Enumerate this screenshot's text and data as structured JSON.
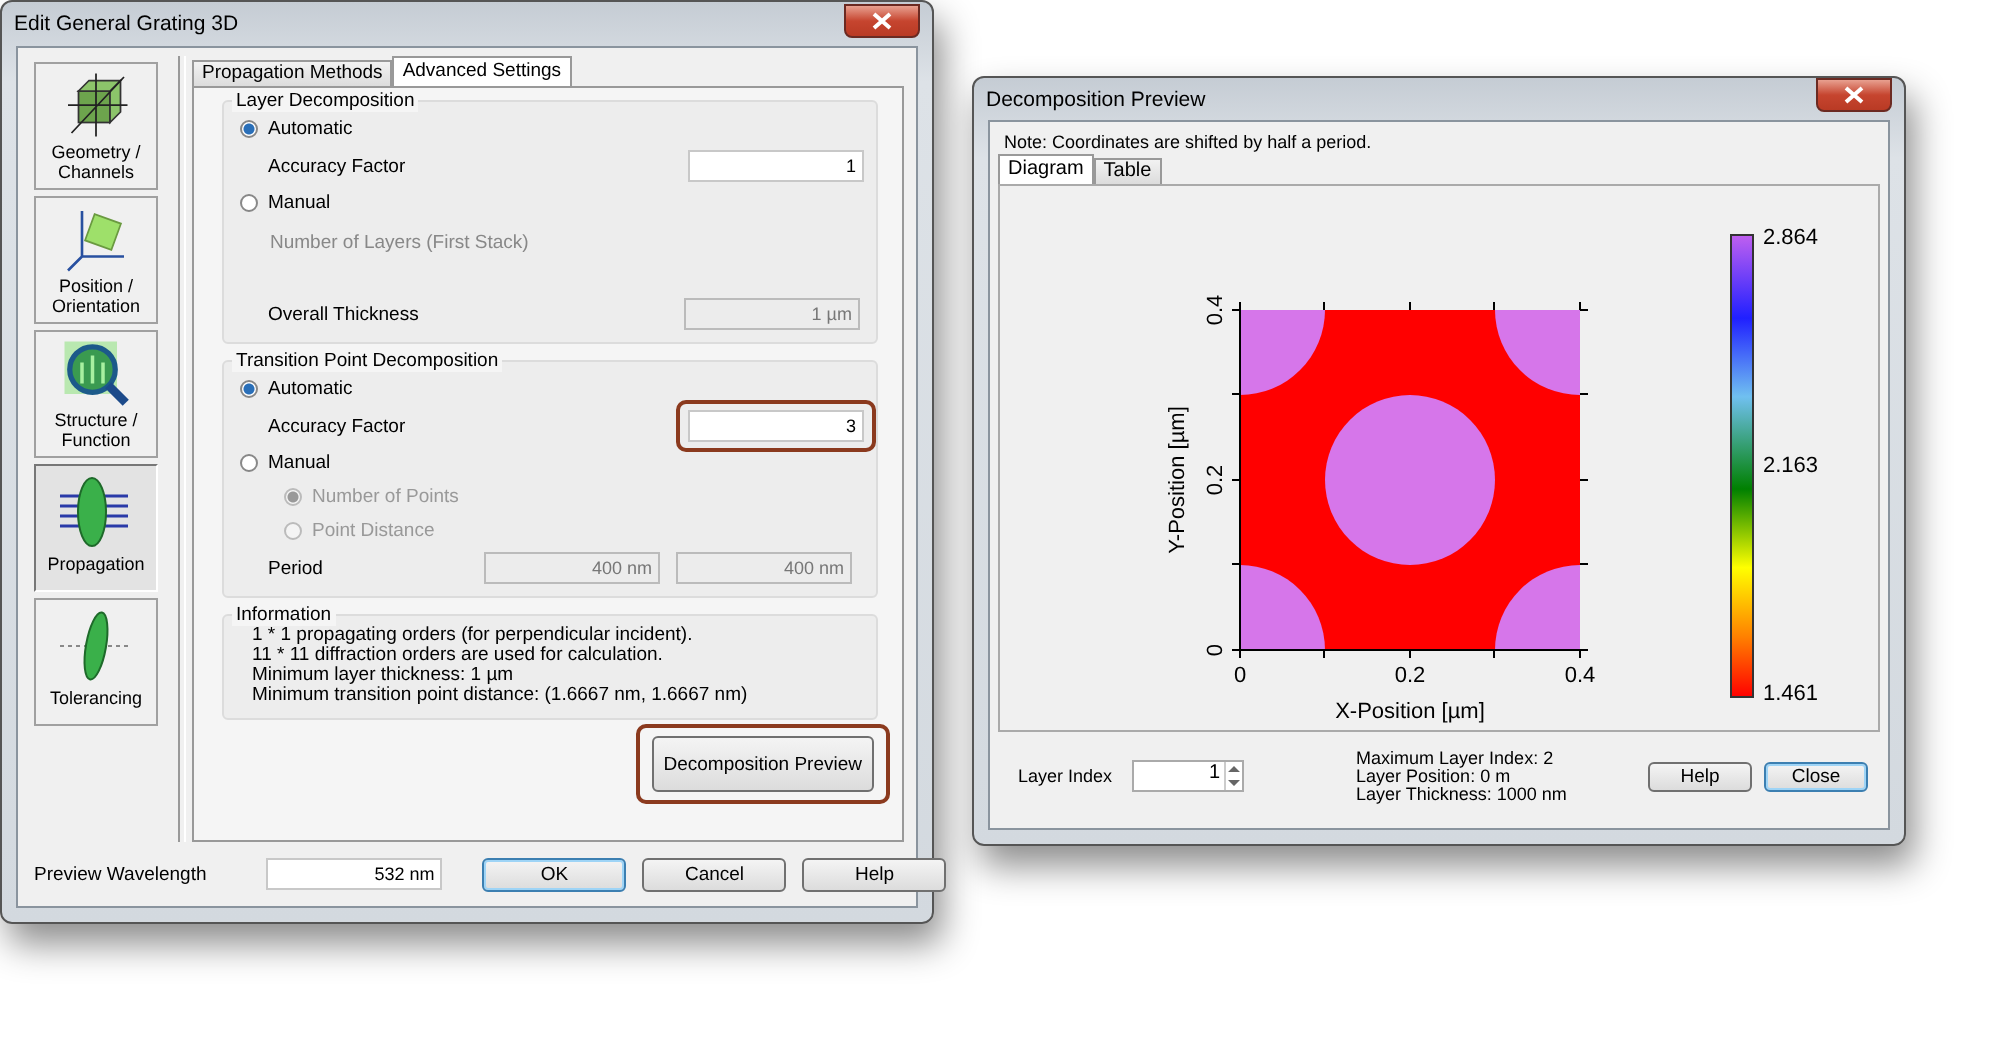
{
  "main_window": {
    "title": "Edit General Grating 3D",
    "sidebar": [
      {
        "label": "Geometry / Channels",
        "kind": "cube",
        "selected": false
      },
      {
        "label": "Position / Orientation",
        "kind": "axes",
        "selected": false
      },
      {
        "label": "Structure / Function",
        "kind": "magnifier",
        "selected": false
      },
      {
        "label": "Propagation",
        "kind": "lens",
        "selected": true
      },
      {
        "label": "Tolerancing",
        "kind": "disc",
        "selected": false
      }
    ],
    "tabs": [
      {
        "label": "Propagation Methods",
        "selected": false
      },
      {
        "label": "Advanced Settings",
        "selected": true
      }
    ],
    "layer_decomposition": {
      "title": "Layer Decomposition",
      "options": [
        {
          "label": "Automatic",
          "selected": true
        },
        {
          "label": "Manual",
          "selected": false
        }
      ],
      "accuracy": {
        "label": "Accuracy Factor",
        "value": "1"
      },
      "layers_label": "Number of Layers (First Stack)",
      "thickness": {
        "label": "Overall Thickness",
        "value": "1 µm",
        "disabled": true
      }
    },
    "transition_decomposition": {
      "title": "Transition Point Decomposition",
      "options": [
        {
          "label": "Automatic",
          "selected": true
        },
        {
          "label": "Manual",
          "selected": false
        }
      ],
      "accuracy": {
        "label": "Accuracy Factor",
        "value": "3",
        "highlighted": true
      },
      "sub_options": [
        {
          "label": "Number of Points",
          "selected": true,
          "disabled": true
        },
        {
          "label": "Point Distance",
          "selected": false,
          "disabled": true
        }
      ],
      "period": {
        "label": "Period",
        "values": [
          "400 nm",
          "400 nm"
        ],
        "disabled": true
      }
    },
    "information": {
      "title": "Information",
      "lines": [
        "1 * 1 propagating orders (for perpendicular incident).",
        "11 * 11 diffraction orders are used for calculation.",
        "Minimum layer thickness: 1 µm",
        "Minimum transition point distance: (1.6667 nm, 1.6667 nm)"
      ]
    },
    "preview_button": {
      "label": "Decomposition Preview",
      "highlighted": true
    },
    "wavelength": {
      "label": "Preview Wavelength",
      "value": "532 nm"
    },
    "buttons": [
      {
        "label": "OK",
        "default": true
      },
      {
        "label": "Cancel",
        "default": false
      },
      {
        "label": "Help",
        "default": false
      }
    ]
  },
  "preview_window": {
    "title": "Decomposition Preview",
    "note": "Note: Coordinates are shifted by half a period.",
    "tabs": [
      {
        "label": "Diagram",
        "selected": true
      },
      {
        "label": "Table",
        "selected": false
      }
    ],
    "plot": {
      "xlabel": "X-Position [µm]",
      "ylabel": "Y-Position [µm]",
      "x_ticks": [
        "0",
        "0.2",
        "0.4"
      ],
      "y_ticks": [
        "0",
        "0.2",
        "0.4"
      ],
      "colorbar_labels": [
        "2.864",
        "2.163",
        "1.461"
      ]
    },
    "layer_index": {
      "label": "Layer Index",
      "value": "1"
    },
    "info_lines": [
      "Maximum Layer Index:  2",
      "Layer Position: 0 m",
      "Layer Thickness: 1000 nm"
    ],
    "buttons": [
      {
        "label": "Help",
        "default": false
      },
      {
        "label": "Close",
        "default": true
      }
    ]
  }
}
